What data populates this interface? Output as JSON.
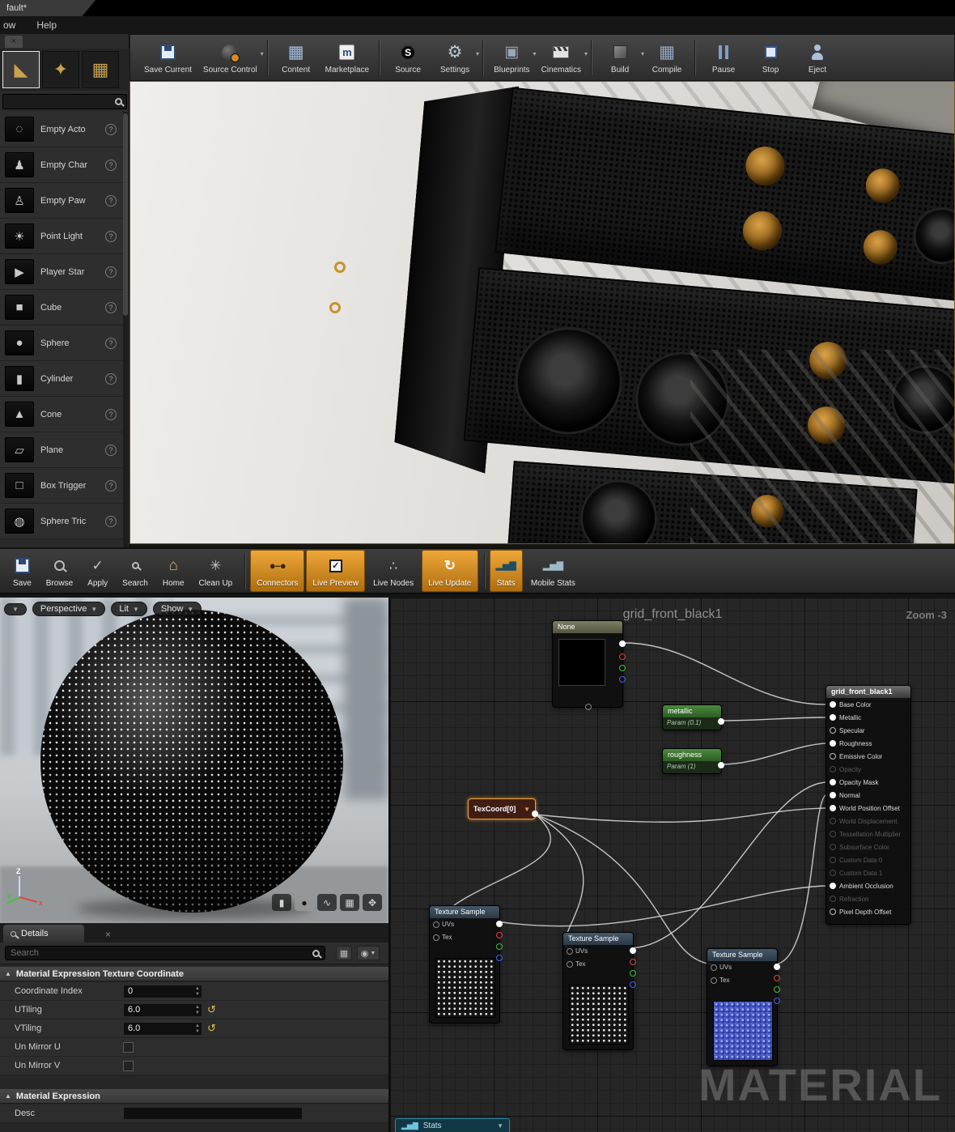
{
  "window": {
    "tab_title": "fault*",
    "menu": [
      "ow",
      "Help"
    ],
    "close_glyph": "×"
  },
  "toolbar": {
    "buttons": [
      {
        "label": "Save Current"
      },
      {
        "label": "Source Control"
      },
      {
        "label": "Content"
      },
      {
        "label": "Marketplace"
      },
      {
        "label": "Source"
      },
      {
        "label": "Settings"
      },
      {
        "label": "Blueprints"
      },
      {
        "label": "Cinematics"
      },
      {
        "label": "Build"
      },
      {
        "label": "Compile"
      },
      {
        "label": "Pause"
      },
      {
        "label": "Stop"
      },
      {
        "label": "Eject"
      }
    ]
  },
  "modes": {
    "items": [
      {
        "label": "Empty Acto",
        "glyph": "◌"
      },
      {
        "label": "Empty Char",
        "glyph": "♟"
      },
      {
        "label": "Empty Paw",
        "glyph": "♙"
      },
      {
        "label": "Point Light",
        "glyph": "☀"
      },
      {
        "label": "Player Star",
        "glyph": "▶"
      },
      {
        "label": "Cube",
        "glyph": "■"
      },
      {
        "label": "Sphere",
        "glyph": "●"
      },
      {
        "label": "Cylinder",
        "glyph": "▮"
      },
      {
        "label": "Cone",
        "glyph": "▲"
      },
      {
        "label": "Plane",
        "glyph": "▱"
      },
      {
        "label": "Box Trigger",
        "glyph": "□"
      },
      {
        "label": "Sphere Tric",
        "glyph": "◍"
      }
    ],
    "help_glyph": "?"
  },
  "material_toolbar": {
    "buttons": [
      {
        "label": "Save"
      },
      {
        "label": "Browse"
      },
      {
        "label": "Apply"
      },
      {
        "label": "Search"
      },
      {
        "label": "Home"
      },
      {
        "label": "Clean Up"
      },
      {
        "label": "Connectors"
      },
      {
        "label": "Live Preview"
      },
      {
        "label": "Live Nodes"
      },
      {
        "label": "Live Update"
      },
      {
        "label": "Stats"
      },
      {
        "label": "Mobile Stats"
      }
    ]
  },
  "preview": {
    "buttons": [
      "Perspective",
      "Lit",
      "Show"
    ],
    "axis": {
      "x": "x",
      "y": "Y",
      "z": "Z"
    }
  },
  "details": {
    "tab": "Details",
    "close_glyph": "×",
    "search_placeholder": "Search",
    "section1": {
      "title": "Material Expression Texture Coordinate",
      "rows": [
        {
          "label": "Coordinate Index",
          "value": "0"
        },
        {
          "label": "UTiling",
          "value": "6.0"
        },
        {
          "label": "VTiling",
          "value": "6.0"
        },
        {
          "label": "Un Mirror U"
        },
        {
          "label": "Un Mirror V"
        }
      ]
    },
    "section2": {
      "title": "Material Expression",
      "rows": [
        {
          "label": "Desc",
          "value": ""
        }
      ]
    }
  },
  "graph": {
    "title": "grid_front_black1",
    "zoom_label": "Zoom -3",
    "watermark": "MATERIAL",
    "stats_tab": "Stats",
    "nodes": {
      "texture_none": {
        "title": "None"
      },
      "metallic": {
        "title": "metallic",
        "subtitle": "Param (0.1)"
      },
      "roughness": {
        "title": "roughness",
        "subtitle": "Param (1)"
      },
      "texcoord": {
        "title": "TexCoord[0]"
      },
      "texture_sample": {
        "title": "Texture Sample",
        "in_pins": [
          "UVs",
          "Tex"
        ]
      },
      "material": {
        "title": "grid_front_black1",
        "pins": [
          {
            "name": "Base Color"
          },
          {
            "name": "Metallic"
          },
          {
            "name": "Specular"
          },
          {
            "name": "Roughness"
          },
          {
            "name": "Emissive Color"
          },
          {
            "name": "Opacity"
          },
          {
            "name": "Opacity Mask"
          },
          {
            "name": "Normal"
          },
          {
            "name": "World Position Offset"
          },
          {
            "name": "World Displacement"
          },
          {
            "name": "Tessellation Multiplier"
          },
          {
            "name": "Subsurface Color"
          },
          {
            "name": "Custom Data 0"
          },
          {
            "name": "Custom Data 1"
          },
          {
            "name": "Ambient Occlusion"
          },
          {
            "name": "Refraction"
          },
          {
            "name": "Pixel Depth Offset"
          }
        ]
      }
    }
  }
}
